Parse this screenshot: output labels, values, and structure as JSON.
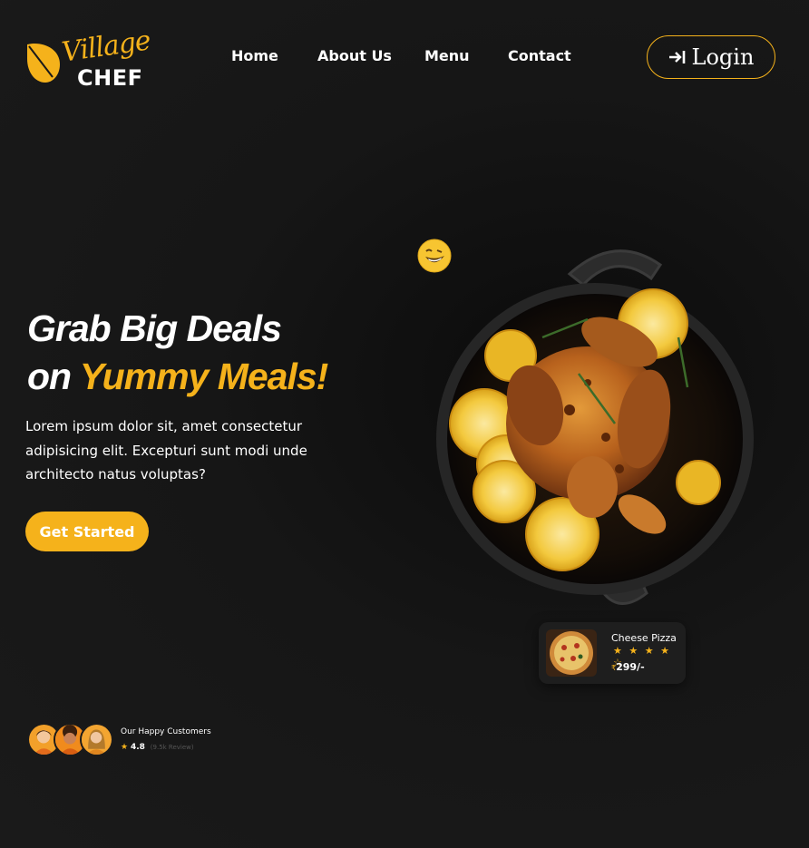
{
  "logo": {
    "script": "Village",
    "word": "CHEF"
  },
  "nav": {
    "items": [
      {
        "label": "Home"
      },
      {
        "label": "About Us"
      },
      {
        "label": "Menu"
      },
      {
        "label": "Contact"
      }
    ],
    "login_label": "Login",
    "login_icon": "sign-in-icon"
  },
  "hero": {
    "title_line1": "Grab Big Deals",
    "title_line2_prefix": "on",
    "title_line2_accent": "Yummy Meals!",
    "description": "Lorem ipsum dolor sit, amet consectetur adipisicing elit. Excepturi sunt modi unde architecto natus voluptas?",
    "cta_label": "Get Started",
    "emoji": "grinning-face-icon"
  },
  "food_card": {
    "name": "Cheese Pizza",
    "stars": "★ ★ ★ ★ ☆",
    "rating": 4,
    "currency": "₹",
    "price": "299/-"
  },
  "customers": {
    "title": "Our Happy Customers",
    "star": "★",
    "rating": "4.8",
    "reviews": "(9.5k Review)"
  },
  "colors": {
    "accent": "#f5b21b",
    "background": "#1a1a1a",
    "text": "#ffffff"
  }
}
